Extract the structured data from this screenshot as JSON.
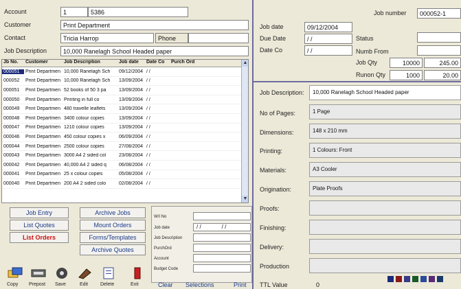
{
  "header": {
    "account_label": "Account",
    "account_value": "1",
    "account_code": "5386",
    "customer_label": "Customer",
    "customer_value": "Print Department",
    "contact_label": "Contact",
    "contact_value": "Tricia Harrop",
    "phone_label": "Phone",
    "jobdesc_label": "Job Description",
    "jobdesc_value": "10,000 Ranelagh School Headed paper"
  },
  "jobinfo": {
    "job_date_label": "Job date",
    "job_date_value": "09/12/2004",
    "due_date_label": "Due Date",
    "due_date_value": "/ /",
    "date_co_label": "Date Co",
    "date_co_value": "/ /",
    "job_number_label": "Job number",
    "job_number_value": "000052-1",
    "status_label": "Status",
    "numb_from_label": "Numb From",
    "job_qty_label": "Job Qty",
    "job_qty_value": "10000",
    "job_qty_price": "245.00",
    "runon_label": "Runon Qty",
    "runon_value": "1000",
    "runon_price": "20.00"
  },
  "grid": {
    "headers": [
      "Jb No.",
      "Customer",
      "Job Description",
      "Job date",
      "Date Co",
      "Purch Ord"
    ],
    "rows": [
      [
        "000051",
        "Print Departmen",
        "10,000 Ranelagh Sch",
        "09/12/2004",
        "/ /",
        ""
      ],
      [
        "000052",
        "Print Departmen",
        "10,000 Ranelagh Sch",
        "13/09/2004",
        "/ /",
        ""
      ],
      [
        "000051",
        "Print Departmen",
        "52 books of 50 3 pa",
        "13/09/2004",
        "/ /",
        ""
      ],
      [
        "000050",
        "Print Departmen",
        "Printing in full co",
        "13/09/2004",
        "/ /",
        ""
      ],
      [
        "000049",
        "Print Departmen",
        "480 travelle leaflets",
        "13/09/2004",
        "/ /",
        ""
      ],
      [
        "000048",
        "Print Departmen",
        "3400 colour copies",
        "13/09/2004",
        "/ /",
        ""
      ],
      [
        "000047",
        "Print Departmen",
        "1210 colour copies",
        "13/09/2004",
        "/ /",
        ""
      ],
      [
        "000046",
        "Print Departmen",
        "450 colour copies x",
        "06/09/2004",
        "/ /",
        ""
      ],
      [
        "000044",
        "Print Departmen",
        "2500 colour copies",
        "27/08/2004",
        "/ /",
        ""
      ],
      [
        "000043",
        "Print Departmen",
        "3000 A4 2 sided col",
        "23/08/2004",
        "/ /",
        ""
      ],
      [
        "000042",
        "Print Departmen",
        "40,000 A4 2 sided q",
        "06/08/2004",
        "/ /",
        ""
      ],
      [
        "000041",
        "Print Departmen",
        "25 x colour copies",
        "05/08/2004",
        "/ /",
        ""
      ],
      [
        "000040",
        "Print Departmen",
        "200 A4 2 sided colo",
        "02/08/2004",
        "/ /",
        ""
      ]
    ]
  },
  "buttons": {
    "job_entry": "Job Entry",
    "archive_jobs": "Archive Jobs",
    "list_quotes": "List Quotes",
    "mount_orders": "Mount Orders",
    "list_orders": "List Orders",
    "forms_templates": "Forms/Templates",
    "archive_quotes": "Archive Quotes"
  },
  "search": {
    "wo_label": "W/I No",
    "job_date_label": "Job date",
    "date_from": "/ /",
    "date_to": "/ /",
    "jobdesc_label": "Job Description",
    "purch_label": "PurchOrd",
    "account_label": "Account",
    "budget_label": "Budget Code",
    "clear": "Clear",
    "selections": "Selections",
    "print": "Print"
  },
  "toolbar": [
    "Copy",
    "Prepost",
    "Save",
    "Edit",
    "Delete",
    "Exit"
  ],
  "details": {
    "job_description_label": "Job Description:",
    "job_description_value": "10,000 Ranelagh School Headed paper",
    "pages_label": "No of Pages:",
    "pages_value": "1 Page",
    "dimensions_label": "Dimensions:",
    "dimensions_value": "148 x 210 mm",
    "printing_label": "Printing:",
    "printing_value": "1 Colours: Front",
    "materials_label": "Materials:",
    "materials_value": "A3 Cooler",
    "origination_label": "Origination:",
    "origination_value": "Plate Proofs",
    "proofs_label": "Proofs:",
    "finishing_label": "Finishing:",
    "delivery_label": "Delivery:",
    "production_label": "Production",
    "ttl_value_label": "TTL Value",
    "ttl_value": "0"
  },
  "colors": {
    "accent": "#1b2a7a",
    "panel_line": "#6a6a9e",
    "red": "#cc1111",
    "link": "#1a3a8a"
  }
}
